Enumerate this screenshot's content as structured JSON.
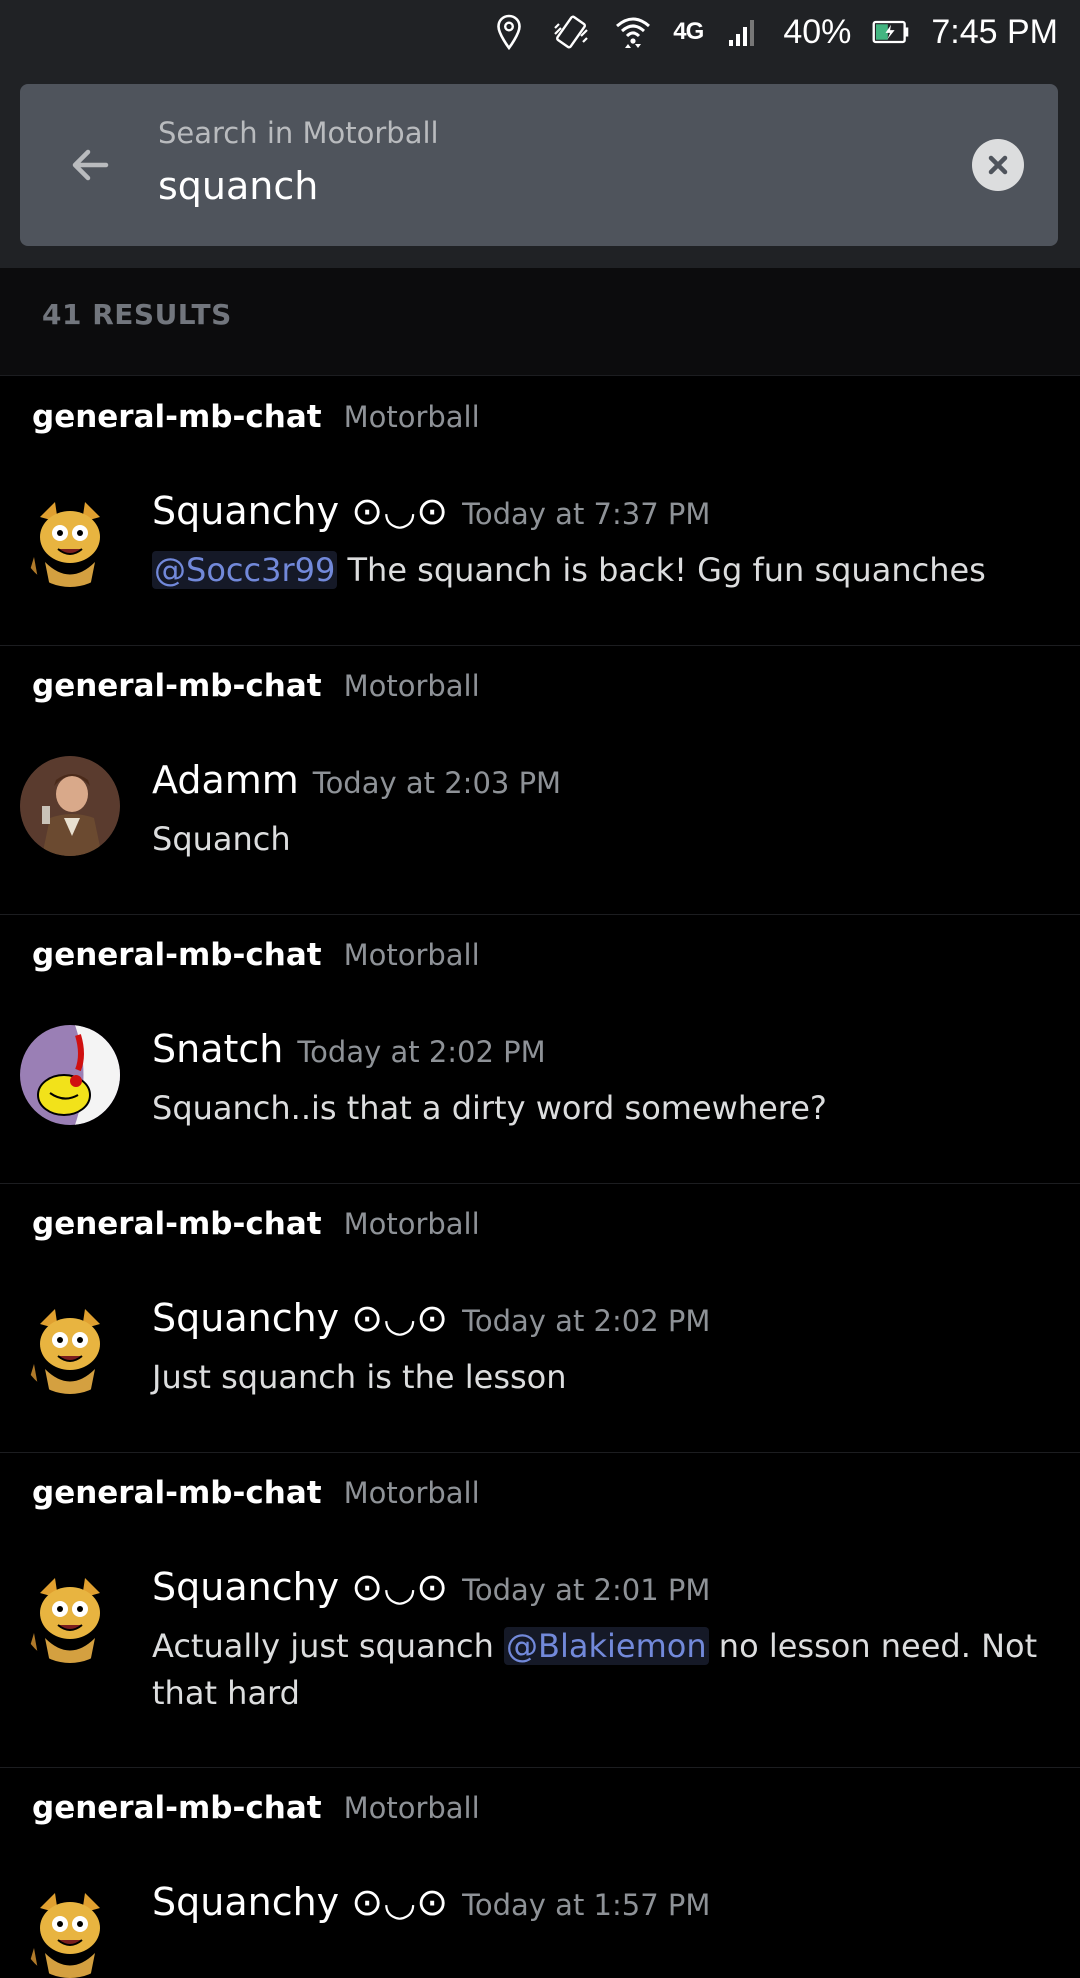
{
  "status_bar": {
    "lte_label": "4G",
    "battery_percent": "40%",
    "time": "7:45 PM"
  },
  "search": {
    "label": "Search in Motorball",
    "query": "squanch"
  },
  "results_count": "41 RESULTS",
  "results": [
    {
      "channel": "general-mb-chat",
      "server": "Motorball",
      "username": "Squanchy ⊙◡⊙",
      "timestamp": "Today at 7:37 PM",
      "mention": "@Socc3r99",
      "text": " The squanch is back! Gg fun squanches",
      "text_after": ""
    },
    {
      "channel": "general-mb-chat",
      "server": "Motorball",
      "username": "Adamm",
      "timestamp": "Today at 2:03 PM",
      "mention": "",
      "text": "Squanch",
      "text_after": ""
    },
    {
      "channel": "general-mb-chat",
      "server": "Motorball",
      "username": "Snatch",
      "timestamp": "Today at 2:02 PM",
      "mention": "",
      "text": "Squanch..is that a dirty word somewhere?",
      "text_after": ""
    },
    {
      "channel": "general-mb-chat",
      "server": "Motorball",
      "username": "Squanchy ⊙◡⊙",
      "timestamp": "Today at 2:02 PM",
      "mention": "",
      "text": "Just squanch is the lesson",
      "text_after": ""
    },
    {
      "channel": "general-mb-chat",
      "server": "Motorball",
      "username": "Squanchy ⊙◡⊙",
      "timestamp": "Today at 2:01 PM",
      "text": "Actually just squanch ",
      "mention": "@Blakiemon",
      "text_after": " no lesson need. Not that hard"
    },
    {
      "channel": "general-mb-chat",
      "server": "Motorball",
      "username": "Squanchy ⊙◡⊙",
      "timestamp": "Today at 1:57 PM",
      "mention": "",
      "text": "",
      "text_after": ""
    }
  ],
  "colors": {
    "background": "#000000",
    "header": "#202225",
    "search_box": "#4f545c",
    "mention": "#7289da",
    "muted": "#8e9297"
  },
  "icons": [
    "location-icon",
    "vibrate-icon",
    "wifi-icon",
    "signal-icon",
    "battery-charging-icon",
    "back-arrow-icon",
    "clear-icon"
  ]
}
